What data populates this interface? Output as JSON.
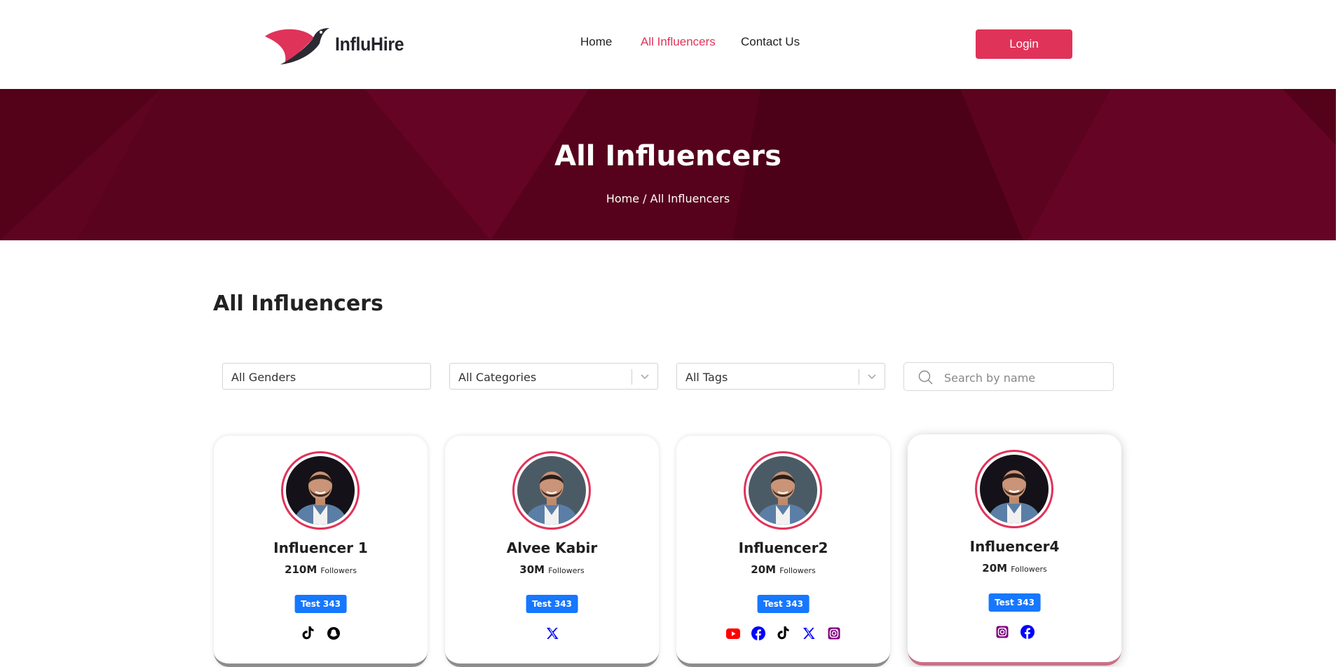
{
  "header": {
    "brand": "InfluHire",
    "nav": [
      {
        "label": "Home",
        "active": false
      },
      {
        "label": "All Influencers",
        "active": true
      },
      {
        "label": "Contact Us",
        "active": false
      }
    ],
    "login_label": "Login"
  },
  "hero": {
    "title": "All Influencers",
    "breadcrumb_home": "Home",
    "breadcrumb_sep": " / ",
    "breadcrumb_current": "All Influencers"
  },
  "main": {
    "title": "All Influencers",
    "filters": {
      "gender": "All Genders",
      "category": "All Categories",
      "tags": "All Tags"
    },
    "search": {
      "placeholder": "Search by name",
      "value": ""
    }
  },
  "influencers": [
    {
      "name": "Influencer 1",
      "followers": "210M",
      "followers_label": "Followers",
      "tag": "Test 343",
      "avatar": "man-dark-background",
      "socials": [
        "tiktok-icon",
        "snapchat-icon"
      ]
    },
    {
      "name": "Alvee Kabir",
      "followers": "30M",
      "followers_label": "Followers",
      "tag": "Test 343",
      "avatar": "man-grey-background",
      "socials": [
        "x-icon"
      ]
    },
    {
      "name": "Influencer2",
      "followers": "20M",
      "followers_label": "Followers",
      "tag": "Test 343",
      "avatar": "man-grey-background",
      "socials": [
        "youtube-icon",
        "facebook-icon",
        "tiktok-icon",
        "x-icon",
        "instagram-icon"
      ]
    },
    {
      "name": "Influencer4",
      "followers": "20M",
      "followers_label": "Followers",
      "tag": "Test 343",
      "avatar": "man-dark-background",
      "socials": [
        "instagram-icon",
        "facebook-icon"
      ]
    }
  ],
  "colors": {
    "accent": "#e0335a",
    "hero_bg": "#5e0320",
    "tag_bg": "#1677ff",
    "youtube": "#ff0000",
    "facebook": "#0000ff",
    "x": "#0000ff",
    "instagram": "#800080",
    "tiktok": "#000000",
    "snapchat": "#000000"
  }
}
